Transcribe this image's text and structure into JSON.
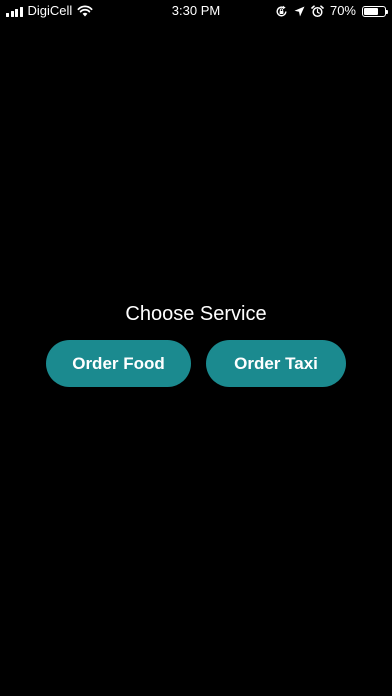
{
  "status_bar": {
    "carrier": "DigiCell",
    "time": "3:30 PM",
    "battery_percent": "70%",
    "battery_level": 0.7,
    "icons": [
      "signal-bars-icon",
      "wifi-icon",
      "rotation-lock-icon",
      "location-arrow-icon",
      "alarm-icon",
      "battery-icon"
    ]
  },
  "main": {
    "title": "Choose Service",
    "buttons": [
      {
        "label": "Order Food"
      },
      {
        "label": "Order Taxi"
      }
    ]
  },
  "colors": {
    "background": "#000000",
    "button": "#1b8a8f",
    "text": "#ffffff"
  }
}
